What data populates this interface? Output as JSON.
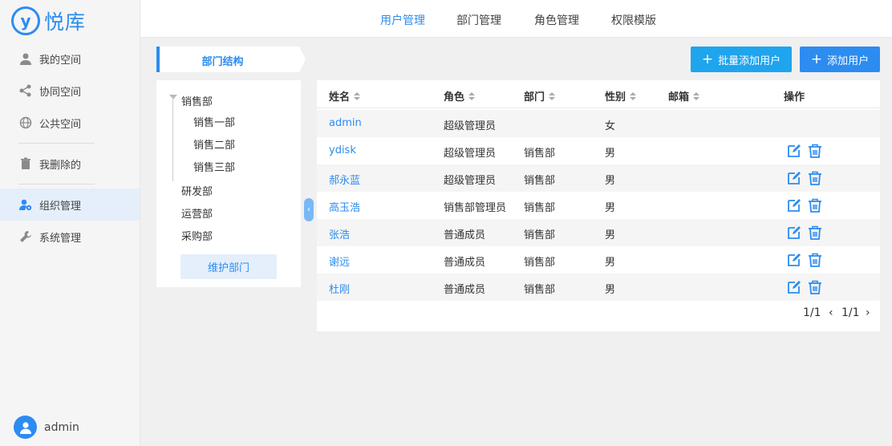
{
  "app": {
    "logo_letter": "y",
    "logo_text": "悦库"
  },
  "sidebar": {
    "items": [
      {
        "label": "我的空间"
      },
      {
        "label": "协同空间"
      },
      {
        "label": "公共空间"
      },
      {
        "label": "我删除的"
      },
      {
        "label": "组织管理"
      },
      {
        "label": "系统管理"
      }
    ],
    "active_index": 4,
    "user": "admin"
  },
  "header": {
    "tabs": [
      {
        "label": "用户管理"
      },
      {
        "label": "部门管理"
      },
      {
        "label": "角色管理"
      },
      {
        "label": "权限模版"
      }
    ],
    "active_index": 0
  },
  "dept": {
    "title": "部门结构",
    "tree": [
      {
        "label": "销售部"
      },
      {
        "label": "销售一部"
      },
      {
        "label": "销售二部"
      },
      {
        "label": "销售三部"
      },
      {
        "label": "研发部"
      },
      {
        "label": "运营部"
      },
      {
        "label": "采购部"
      }
    ],
    "maintain_label": "维护部门"
  },
  "actions": {
    "batch_add": "批量添加用户",
    "add": "添加用户"
  },
  "table": {
    "headers": {
      "name": "姓名",
      "role": "角色",
      "dept": "部门",
      "gender": "性别",
      "email": "邮箱",
      "ops": "操作"
    },
    "rows": [
      {
        "name": "admin",
        "role": "超级管理员",
        "dept": "",
        "gender": "女"
      },
      {
        "name": "ydisk",
        "role": "超级管理员",
        "dept": "销售部",
        "gender": "男"
      },
      {
        "name": "郝永蓝",
        "role": "超级管理员",
        "dept": "销售部",
        "gender": "男"
      },
      {
        "name": "高玉浩",
        "role": "销售部管理员",
        "dept": "销售部",
        "gender": "男"
      },
      {
        "name": "张浩",
        "role": "普通成员",
        "dept": "销售部",
        "gender": "男"
      },
      {
        "name": "谢远",
        "role": "普通成员",
        "dept": "销售部",
        "gender": "男"
      },
      {
        "name": "杜刚",
        "role": "普通成员",
        "dept": "销售部",
        "gender": "男"
      }
    ]
  },
  "pagination": {
    "summary": "1/1",
    "current": "1/1"
  },
  "colors": {
    "accent": "#2d8cf0",
    "batch": "#1fa4ee",
    "active_bg": "#e5effb"
  }
}
